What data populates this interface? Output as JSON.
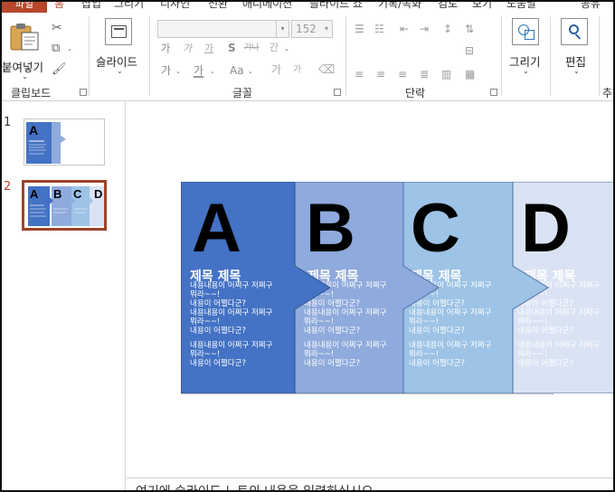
{
  "ribbon": {
    "tabs": [
      {
        "label": "파일",
        "active": false
      },
      {
        "label": "홈",
        "active": true
      },
      {
        "label": "삽입",
        "active": false
      },
      {
        "label": "그리기",
        "active": false
      },
      {
        "label": "디자인",
        "active": false
      },
      {
        "label": "전환",
        "active": false
      },
      {
        "label": "애니메이션",
        "active": false
      },
      {
        "label": "슬라이드 쇼",
        "active": false
      },
      {
        "label": "기록/녹화",
        "active": false
      },
      {
        "label": "검토",
        "active": false
      },
      {
        "label": "보기",
        "active": false
      },
      {
        "label": "도움말",
        "active": false
      },
      {
        "label": "공유",
        "active": false
      }
    ],
    "clipboard": {
      "paste_label": "붙여넣기",
      "group_label": "클립보드"
    },
    "slides": {
      "new_slide_label": "슬라이드",
      "group_label": ""
    },
    "font": {
      "font_name": "",
      "font_size": "152",
      "group_label": "글꼴",
      "bold_glyph": "가",
      "italic_glyph": "가",
      "underline_glyph": "가",
      "shadow_glyph": "S",
      "strike_glyph": "가나",
      "spacing_glyph": "간",
      "case_glyph": "Aa",
      "grow_glyph": "가",
      "shrink_glyph": "가",
      "color_glyph": "가",
      "highlight_glyph": "가"
    },
    "paragraph": {
      "group_label": "단락"
    },
    "drawing": {
      "label": "그리기"
    },
    "editing": {
      "label": "편집"
    },
    "more_label": "추"
  },
  "thumbnails": [
    {
      "number": "1",
      "selected": false
    },
    {
      "number": "2",
      "selected": true
    }
  ],
  "slide": {
    "panels": [
      {
        "letter": "A",
        "title": "제목 제목",
        "color": "#4472c4",
        "lines": [
          "내용내용이 어쩌구 저쩌구",
          "뭐라~~!",
          "내용이 어쩔다군?",
          "내용내용이 어쩌구 저쩌구",
          "뭐라~~!",
          "내용이 어쩔다군?",
          "",
          "내용내용이 어쩌구 저쩌구",
          "뭐라~~!",
          "내용이 어쩔다군?"
        ]
      },
      {
        "letter": "B",
        "title": "제목 제목",
        "color": "#8faadc",
        "lines": [
          "내용내용이 어쩌구 저쩌구",
          "뭐라~~!",
          "내용이 어쩔다군?",
          "내용내용이 어쩌구 저쩌구",
          "뭐라~~!",
          "내용이 어쩔다군?",
          "",
          "내용내용이 어쩌구 저쩌구",
          "뭐라~~!",
          "내용이 어쩔다군?"
        ]
      },
      {
        "letter": "C",
        "title": "제목 제목",
        "color": "#9dc3e6",
        "lines": [
          "내용내용이 어쩌구 저쩌구",
          "뭐라~~!",
          "내용이 어쩔다군?",
          "내용내용이 어쩌구 저쩌구",
          "뭐라~~!",
          "내용이 어쩔다군?",
          "",
          "내용내용이 어쩌구 저쩌구",
          "뭐라~~!",
          "내용이 어쩔다군?"
        ]
      },
      {
        "letter": "D",
        "title": "제목 제목",
        "color": "#dae3f3",
        "lines": [
          "내용내용이 어쩌구 저쩌구",
          "뭐라~~!",
          "내용이 어쩔다군?",
          "내용내용이 어쩌구 저쩌구",
          "뭐라~~!",
          "내용이 어쩔다군?",
          "",
          "내용내용이 어쩌구 저쩌구",
          "뭐라~~!",
          "내용이 어쩔다군?"
        ]
      }
    ]
  },
  "notes": {
    "placeholder": "여기에 슬라이드 노트의 내용을 입력하십시오"
  }
}
